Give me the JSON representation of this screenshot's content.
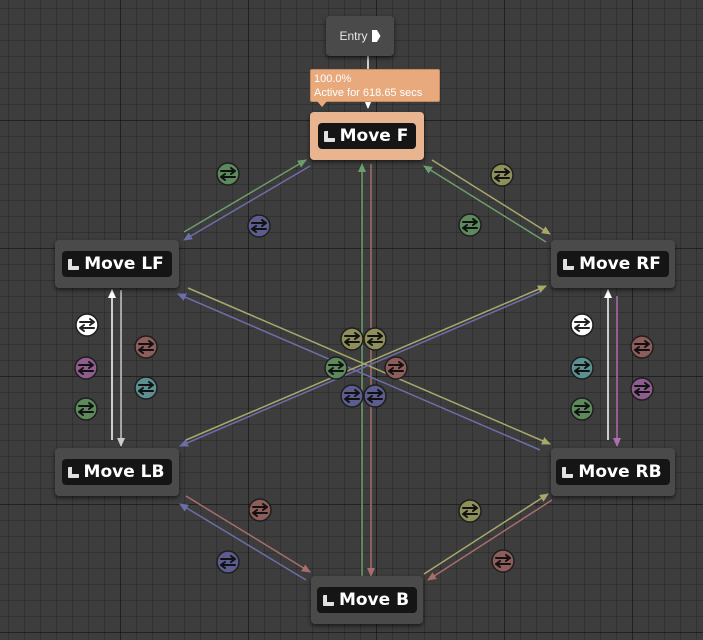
{
  "entry": {
    "label": "Entry"
  },
  "debug": {
    "percent": "100.0%",
    "active_text": "Active for 618.65 secs"
  },
  "states": {
    "move_f": "Move F",
    "move_lf": "Move LF",
    "move_rf": "Move RF",
    "move_lb": "Move LB",
    "move_rb": "Move RB",
    "move_b": "Move B"
  },
  "colors": {
    "background": "#3d3d3d",
    "node": "#4a4a4a",
    "active_node": "#e9b591",
    "tooltip": "#e8a97c",
    "rule_green": "#5c8a5c",
    "rule_purple": "#5c5c8f",
    "rule_olive": "#8f8f5c",
    "rule_red": "#8f5c5c",
    "rule_magenta": "#8f5c8f",
    "rule_teal": "#5c8f8f",
    "rule_white": "#ffffff"
  },
  "transition_icon": "two-way-arrows-icon"
}
